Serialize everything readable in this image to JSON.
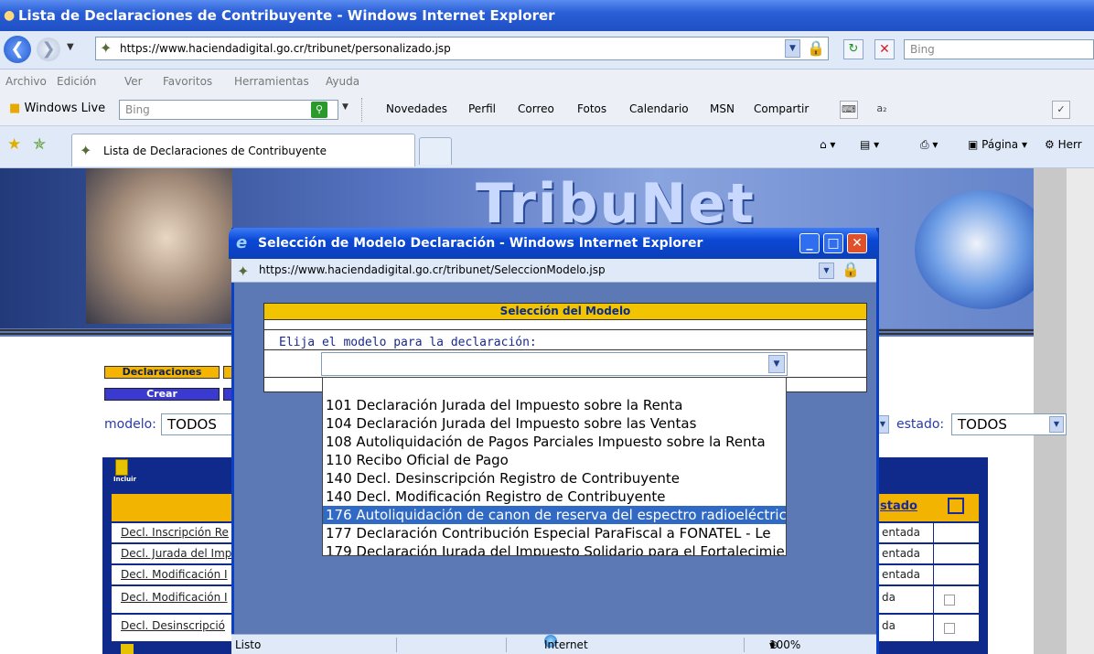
{
  "window": {
    "title": "Lista de Declaraciones de Contribuyente - Windows Internet Explorer"
  },
  "browser": {
    "url": "https://www.haciendadigital.go.cr/tribunet/personalizado.jsp",
    "search_placeholder": "Bing",
    "menu": [
      "Archivo",
      "Edición",
      "Ver",
      "Favoritos",
      "Herramientas",
      "Ayuda"
    ],
    "windows_live": {
      "label": "Windows Live",
      "search_placeholder": "Bing",
      "links": [
        "Novedades",
        "Perfil",
        "Correo",
        "Fotos",
        "Calendario",
        "MSN",
        "Compartir"
      ]
    },
    "tab_label": "Lista de Declaraciones de Contribuyente",
    "commands": {
      "page": "Página",
      "tools": "Herr"
    }
  },
  "page": {
    "logo": "TribuNet",
    "nav": {
      "declaraciones": "Declaraciones",
      "crear": "Crear"
    },
    "filters": {
      "modelo_label": "modelo:",
      "modelo_value": "TODOS",
      "estado_label": "estado:",
      "estado_value": "TODOS"
    },
    "table": {
      "incluir_label": "Incluir",
      "estado_header": "stado",
      "rows": [
        {
          "name": "Decl. Inscripción Re",
          "state": "entada",
          "checkbox": false
        },
        {
          "name": "Decl. Jurada del Imp",
          "state": "entada",
          "checkbox": false
        },
        {
          "name": "Decl. Modificación I",
          "state": "entada",
          "checkbox": false
        },
        {
          "name": "Decl. Modificación I",
          "state": "da",
          "checkbox": true
        },
        {
          "name": "Decl. Desinscripció",
          "state": "da",
          "checkbox": true
        }
      ]
    }
  },
  "popup": {
    "title": "Selección de Modelo Declaración - Windows Internet Explorer",
    "url": "https://www.haciendadigital.go.cr/tribunet/SeleccionModelo.jsp",
    "panel_title": "Selección del Modelo",
    "prompt": "Elija el modelo para la declaración:",
    "options": [
      "101 Declaración Jurada del Impuesto sobre la Renta",
      "104 Declaración Jurada del Impuesto sobre las Ventas",
      "108 Autoliquidación de Pagos Parciales Impuesto sobre la Renta",
      "110 Recibo Oficial de Pago",
      "140 Decl. Desinscripción Registro de Contribuyente",
      "140 Decl. Modificación Registro de Contribuyente",
      "176 Autoliquidación de canon de reserva del espectro radioeléctrico",
      "177 Declaración Contribución Especial ParaFiscal a FONATEL - Le",
      "179 Declaración Jurada del Impuesto Solidario para el Fortalecimie"
    ],
    "selected_option_index": 6,
    "status": {
      "text": "Listo",
      "zone": "Internet",
      "zoom": "100%"
    }
  }
}
